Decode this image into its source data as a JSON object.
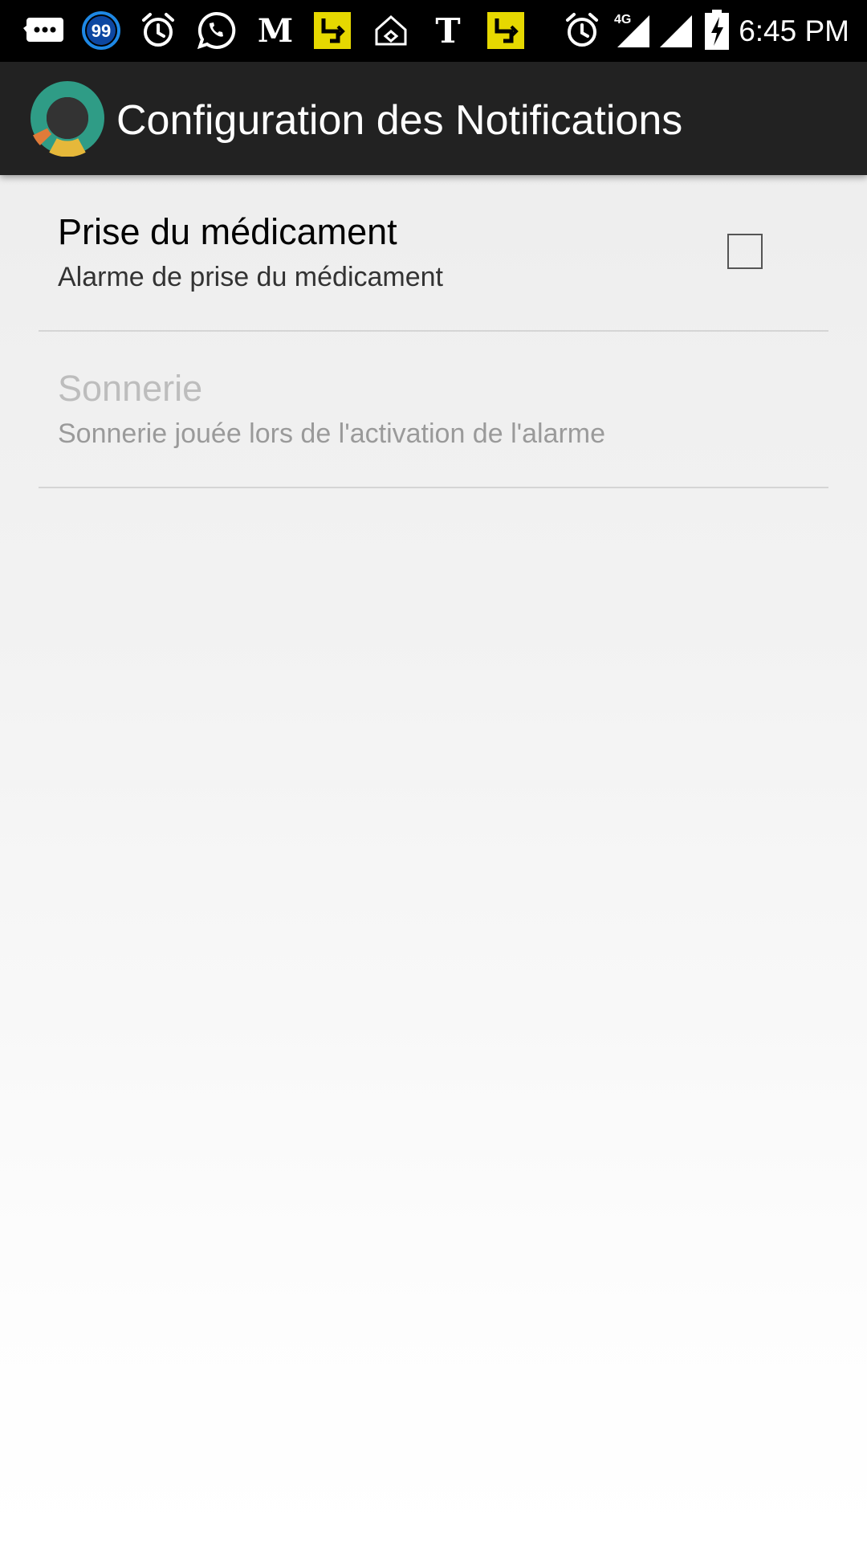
{
  "status_bar": {
    "time": "6:45 PM",
    "notification_icons": [
      "messages-icon",
      "badge-99-icon",
      "alarm-icon",
      "whatsapp-icon",
      "le-monde-icon",
      "yellow-app-icon",
      "home-app-icon",
      "nytimes-icon",
      "yellow-app-icon"
    ],
    "badge_count": "99",
    "network_type": "4G",
    "system_icons": [
      "alarm-icon",
      "signal-4g-icon",
      "signal-icon",
      "battery-charging-icon"
    ]
  },
  "action_bar": {
    "title": "Configuration des Notifications",
    "logo_icon": "app-ring-logo-icon"
  },
  "preferences": [
    {
      "title": "Prise du médicament",
      "summary": "Alarme de prise du médicament",
      "enabled": true,
      "checked": false
    },
    {
      "title": "Sonnerie",
      "summary": "Sonnerie jouée lors de l'activation de l'alarme",
      "enabled": false
    }
  ],
  "colors": {
    "status_bar_bg": "#000000",
    "action_bar_bg": "#222222",
    "logo_teal": "#2f9c86",
    "logo_orange": "#e07b39",
    "logo_yellow": "#e6b83a",
    "notification_yellow": "#e6d800",
    "badge_blue": "#1e88e5"
  }
}
